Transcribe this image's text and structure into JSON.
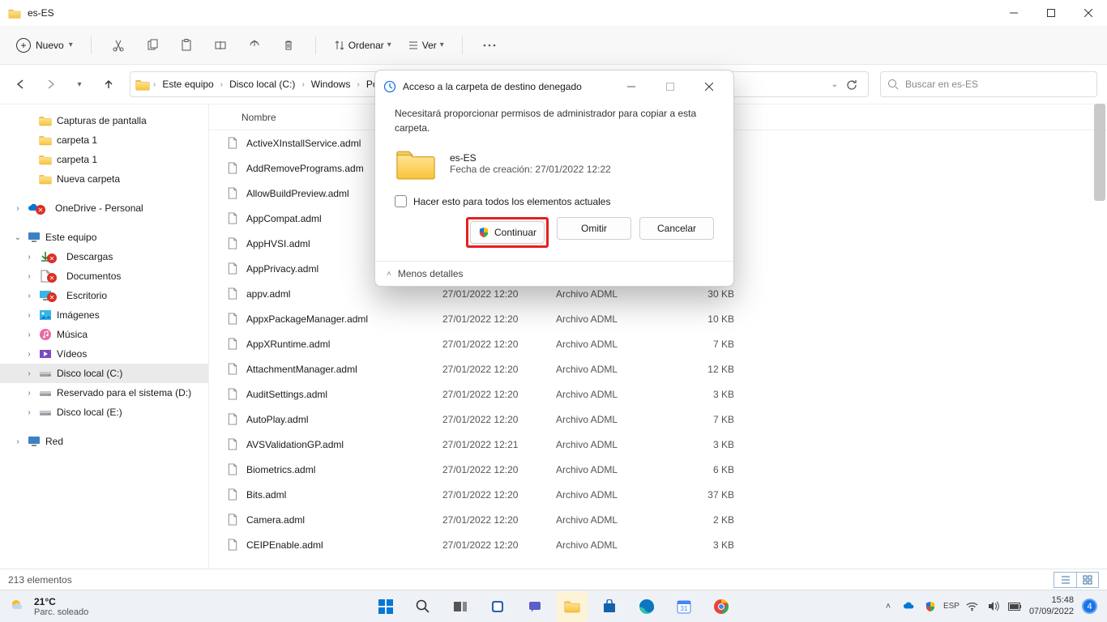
{
  "titlebar": {
    "title": "es-ES"
  },
  "toolbar": {
    "new_label": "Nuevo",
    "sort_label": "Ordenar",
    "view_label": "Ver"
  },
  "breadcrumb": [
    "Este equipo",
    "Disco local (C:)",
    "Windows",
    "Poli"
  ],
  "search_placeholder": "Buscar en es-ES",
  "sidebar": {
    "quick": [
      {
        "label": "Capturas de pantalla",
        "icon": "folder"
      },
      {
        "label": "carpeta 1",
        "icon": "folder"
      },
      {
        "label": "carpeta 1",
        "icon": "folder"
      },
      {
        "label": "Nueva carpeta",
        "icon": "folder"
      }
    ],
    "onedrive": "OneDrive - Personal",
    "thispc": "Este equipo",
    "thispc_items": [
      {
        "label": "Descargas",
        "icon": "downloads"
      },
      {
        "label": "Documentos",
        "icon": "documents"
      },
      {
        "label": "Escritorio",
        "icon": "desktop"
      },
      {
        "label": "Imágenes",
        "icon": "pictures"
      },
      {
        "label": "Música",
        "icon": "music"
      },
      {
        "label": "Vídeos",
        "icon": "videos"
      },
      {
        "label": "Disco local (C:)",
        "icon": "drive",
        "selected": true
      },
      {
        "label": "Reservado para el sistema (D:)",
        "icon": "drive"
      },
      {
        "label": "Disco local (E:)",
        "icon": "drive"
      }
    ],
    "network": "Red"
  },
  "columns": {
    "name": "Nombre",
    "date": "",
    "type": "",
    "size": ""
  },
  "files": [
    {
      "name": "ActiveXInstallService.adml",
      "date": "",
      "type": "",
      "size": ""
    },
    {
      "name": "AddRemovePrograms.adm",
      "date": "",
      "type": "",
      "size": ""
    },
    {
      "name": "AllowBuildPreview.adml",
      "date": "",
      "type": "",
      "size": ""
    },
    {
      "name": "AppCompat.adml",
      "date": "",
      "type": "",
      "size": ""
    },
    {
      "name": "AppHVSI.adml",
      "date": "",
      "type": "",
      "size": ""
    },
    {
      "name": "AppPrivacy.adml",
      "date": "",
      "type": "",
      "size": ""
    },
    {
      "name": "appv.adml",
      "date": "27/01/2022 12:20",
      "type": "Archivo ADML",
      "size": "30 KB"
    },
    {
      "name": "AppxPackageManager.adml",
      "date": "27/01/2022 12:20",
      "type": "Archivo ADML",
      "size": "10 KB"
    },
    {
      "name": "AppXRuntime.adml",
      "date": "27/01/2022 12:20",
      "type": "Archivo ADML",
      "size": "7 KB"
    },
    {
      "name": "AttachmentManager.adml",
      "date": "27/01/2022 12:20",
      "type": "Archivo ADML",
      "size": "12 KB"
    },
    {
      "name": "AuditSettings.adml",
      "date": "27/01/2022 12:20",
      "type": "Archivo ADML",
      "size": "3 KB"
    },
    {
      "name": "AutoPlay.adml",
      "date": "27/01/2022 12:20",
      "type": "Archivo ADML",
      "size": "7 KB"
    },
    {
      "name": "AVSValidationGP.adml",
      "date": "27/01/2022 12:21",
      "type": "Archivo ADML",
      "size": "3 KB"
    },
    {
      "name": "Biometrics.adml",
      "date": "27/01/2022 12:20",
      "type": "Archivo ADML",
      "size": "6 KB"
    },
    {
      "name": "Bits.adml",
      "date": "27/01/2022 12:20",
      "type": "Archivo ADML",
      "size": "37 KB"
    },
    {
      "name": "Camera.adml",
      "date": "27/01/2022 12:20",
      "type": "Archivo ADML",
      "size": "2 KB"
    },
    {
      "name": "CEIPEnable.adml",
      "date": "27/01/2022 12:20",
      "type": "Archivo ADML",
      "size": "3 KB"
    }
  ],
  "statusbar": {
    "count_label": "213 elementos"
  },
  "modal": {
    "title": "Acceso a la carpeta de destino denegado",
    "message": "Necesitará proporcionar permisos de administrador para copiar a esta carpeta.",
    "folder_name": "es-ES",
    "folder_meta": "Fecha de creación: 27/01/2022 12:22",
    "check_label": "Hacer esto para todos los elementos actuales",
    "btn_continue": "Continuar",
    "btn_skip": "Omitir",
    "btn_cancel": "Cancelar",
    "less_details": "Menos detalles"
  },
  "taskbar": {
    "weather_temp": "21°C",
    "weather_desc": "Parc. soleado",
    "clock_time": "15:48",
    "clock_date": "07/09/2022",
    "notif_count": "4"
  }
}
